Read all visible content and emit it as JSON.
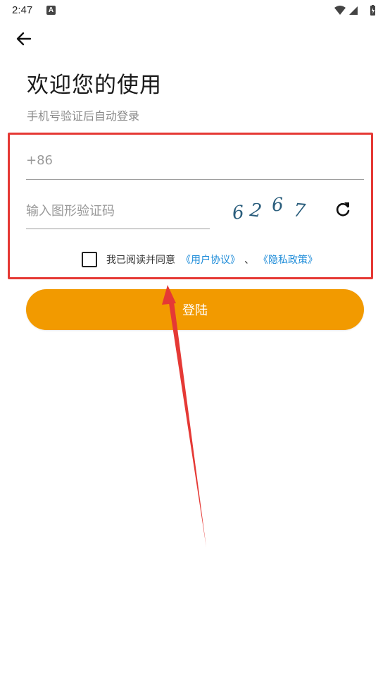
{
  "status_bar": {
    "time": "2:47",
    "notification_icon": "A"
  },
  "header": {
    "title": "欢迎您的使用",
    "subtitle": "手机号验证后自动登录"
  },
  "form": {
    "phone": {
      "placeholder": "+86",
      "value": ""
    },
    "captcha": {
      "placeholder": "输入图形验证码",
      "value": ""
    },
    "captcha_image_chars": [
      "6",
      "2",
      "6",
      "7"
    ],
    "agreement": {
      "prefix": "我已阅读并同意",
      "user_agreement": "《用户协议》",
      "separator": "、",
      "privacy_policy": "《隐私政策》",
      "checked": false
    },
    "submit_label": "登陆"
  },
  "colors": {
    "accent": "#f29a00",
    "link": "#1a8ad8",
    "annotation": "#e53935"
  },
  "icons": {
    "back": "arrow-left-icon",
    "refresh": "refresh-icon",
    "wifi": "wifi-icon",
    "signal": "signal-icon",
    "battery": "battery-icon"
  }
}
